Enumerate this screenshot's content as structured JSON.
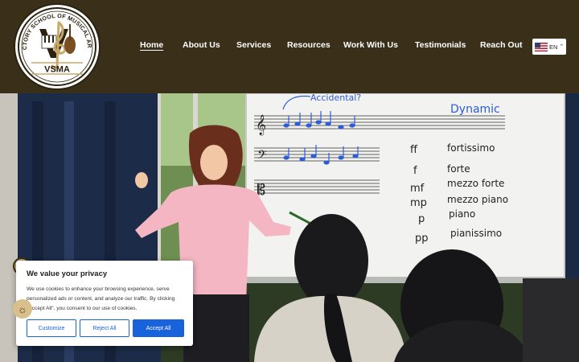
{
  "logo": {
    "top_text": "VICTORY SCHOOL OF MUSICAL ARTS",
    "abbr": "VSMA"
  },
  "nav": {
    "items": [
      "Home",
      "About Us",
      "Services",
      "Resources",
      "Work With Us",
      "Testimonials",
      "Reach Out"
    ]
  },
  "language": {
    "code": "EN",
    "flag_icon": "us-flag-icon"
  },
  "hero": {
    "whiteboard": {
      "accidental_label": "Accidental?",
      "dynamic_label": "Dynamic",
      "dynamics": [
        {
          "symbol": "ff",
          "name": "fortissimo"
        },
        {
          "symbol": "f",
          "name": "forte"
        },
        {
          "symbol": "mf",
          "name": "mezzo forte"
        },
        {
          "symbol": "mp",
          "name": "mezzo piano"
        },
        {
          "symbol": "p",
          "name": "piano"
        },
        {
          "symbol": "pp",
          "name": "pianissimo"
        }
      ]
    }
  },
  "consent": {
    "title": "We value your privacy",
    "body": "We use cookies to enhance your browsing experience, serve personalized ads or content, and analyze our traffic. By clicking \"Accept All\", you consent to our use of cookies.",
    "customize": "Customize",
    "reject": "Reject All",
    "accept": "Accept All"
  },
  "colors": {
    "header_bg": "#3a3019",
    "accent_blue": "#1863dc",
    "gold": "#c8a96a"
  }
}
